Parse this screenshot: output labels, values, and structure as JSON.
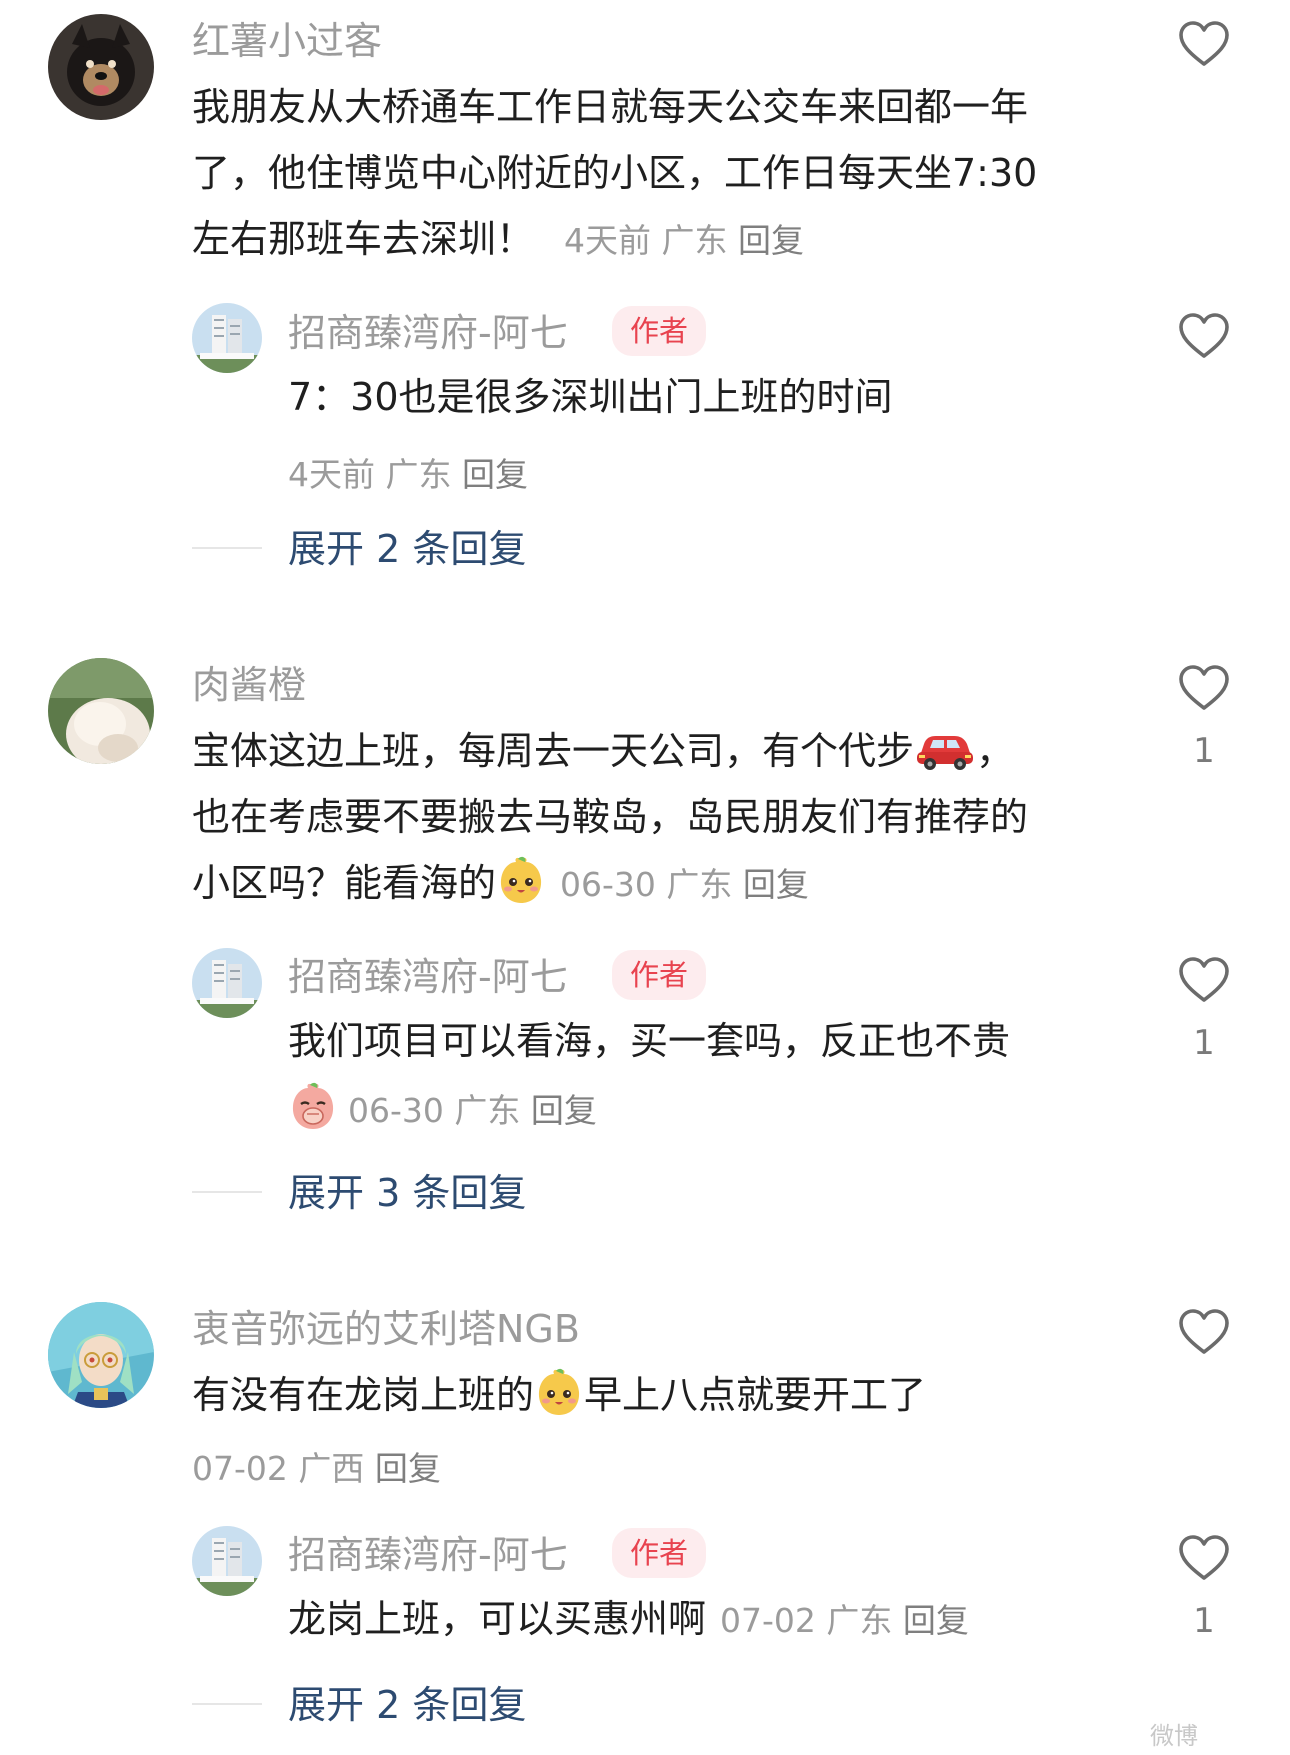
{
  "comments": [
    {
      "username": "红薯小过客",
      "avatar": "dog-avatar",
      "text": "我朋友从大桥通车工作日就每天公交车来回都一年了，他住博览中心附近的小区，工作日每天坐7:30左右那班车去深圳！",
      "text_lines": [
        "我朋友从大桥通车工作日就每天公交车来回都一年",
        "了，他住博览中心附近的小区，工作日每天坐7:30",
        "左右那班车去深圳！"
      ],
      "time": "4天前",
      "location": "广东",
      "reply_label": "回复",
      "likes": "",
      "reply": {
        "username": "招商臻湾府-阿七",
        "badge": "作者",
        "text": "7：30也是很多深圳出门上班的时间",
        "time": "4天前",
        "location": "广东",
        "reply_label": "回复",
        "likes": ""
      },
      "expand_label": "展开 2 条回复"
    },
    {
      "username": "肉酱橙",
      "avatar": "fluffy-pet-avatar",
      "text_lines": [
        "宝体这边上班，每周去一天公司，有个代步",
        "也在考虑要不要搬去马鞍岛，岛民朋友们有推荐的",
        "小区吗？能看海的"
      ],
      "line1_suffix": "，",
      "time": "06-30",
      "location": "广东",
      "reply_label": "回复",
      "likes": "1",
      "reply": {
        "username": "招商臻湾府-阿七",
        "badge": "作者",
        "text": "我们项目可以看海，买一套吗，反正也不贵",
        "time": "06-30",
        "location": "广东",
        "reply_label": "回复",
        "likes": "1"
      },
      "expand_label": "展开 3 条回复"
    },
    {
      "username": "衷音弥远的艾利塔NGB",
      "avatar": "anime-character-avatar",
      "text_before_emoji": "有没有在龙岗上班的",
      "text_after_emoji": "早上八点就要开工了",
      "time": "07-02",
      "location": "广西",
      "reply_label": "回复",
      "likes": "",
      "reply": {
        "username": "招商臻湾府-阿七",
        "badge": "作者",
        "text": "龙岗上班，可以买惠州啊",
        "time": "07-02",
        "location": "广东",
        "reply_label": "回复",
        "likes": "1"
      },
      "expand_label": "展开 2 条回复"
    }
  ],
  "watermark": "微博"
}
